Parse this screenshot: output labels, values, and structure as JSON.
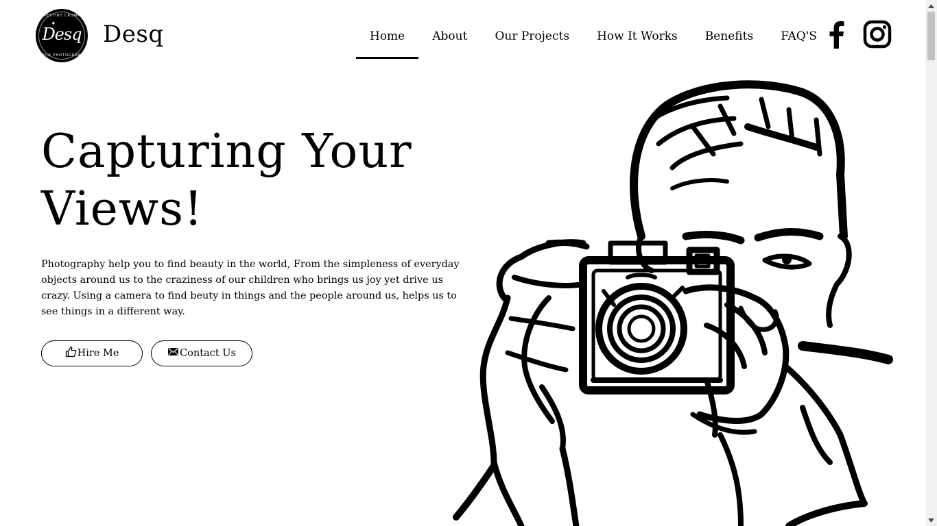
{
  "brand": {
    "logo_monogram": "Desq",
    "logo_ring_top": "DESTINY CRUMP",
    "logo_ring_bottom": "MEDIA PHOTOGRAPHY",
    "name": "Desq"
  },
  "nav": {
    "items": [
      {
        "label": "Home",
        "active": true
      },
      {
        "label": "About"
      },
      {
        "label": "Our Projects"
      },
      {
        "label": "How It Works"
      },
      {
        "label": "Benefits"
      },
      {
        "label": "FAQ'S"
      }
    ]
  },
  "social": {
    "facebook_icon": "facebook-icon",
    "instagram_icon": "instagram-icon"
  },
  "hero": {
    "headline_line1": "Capturing Your",
    "headline_line2": "Views!",
    "intro": "Photography help you to find beauty in the world, From the simpleness of everyday objects around us to the craziness of our children who brings us joy yet drive us crazy. Using a camera to find beuty in things and the people around us, helps us to see things in a different way.",
    "hire_label": "Hire Me",
    "hire_icon": "thumbs-up-icon",
    "contact_label": "Contact Us",
    "contact_icon": "envelope-icon",
    "illustration": "photographer-illustration"
  },
  "colors": {
    "background": "#ffffff",
    "text": "#000000",
    "accent": "#000000"
  }
}
